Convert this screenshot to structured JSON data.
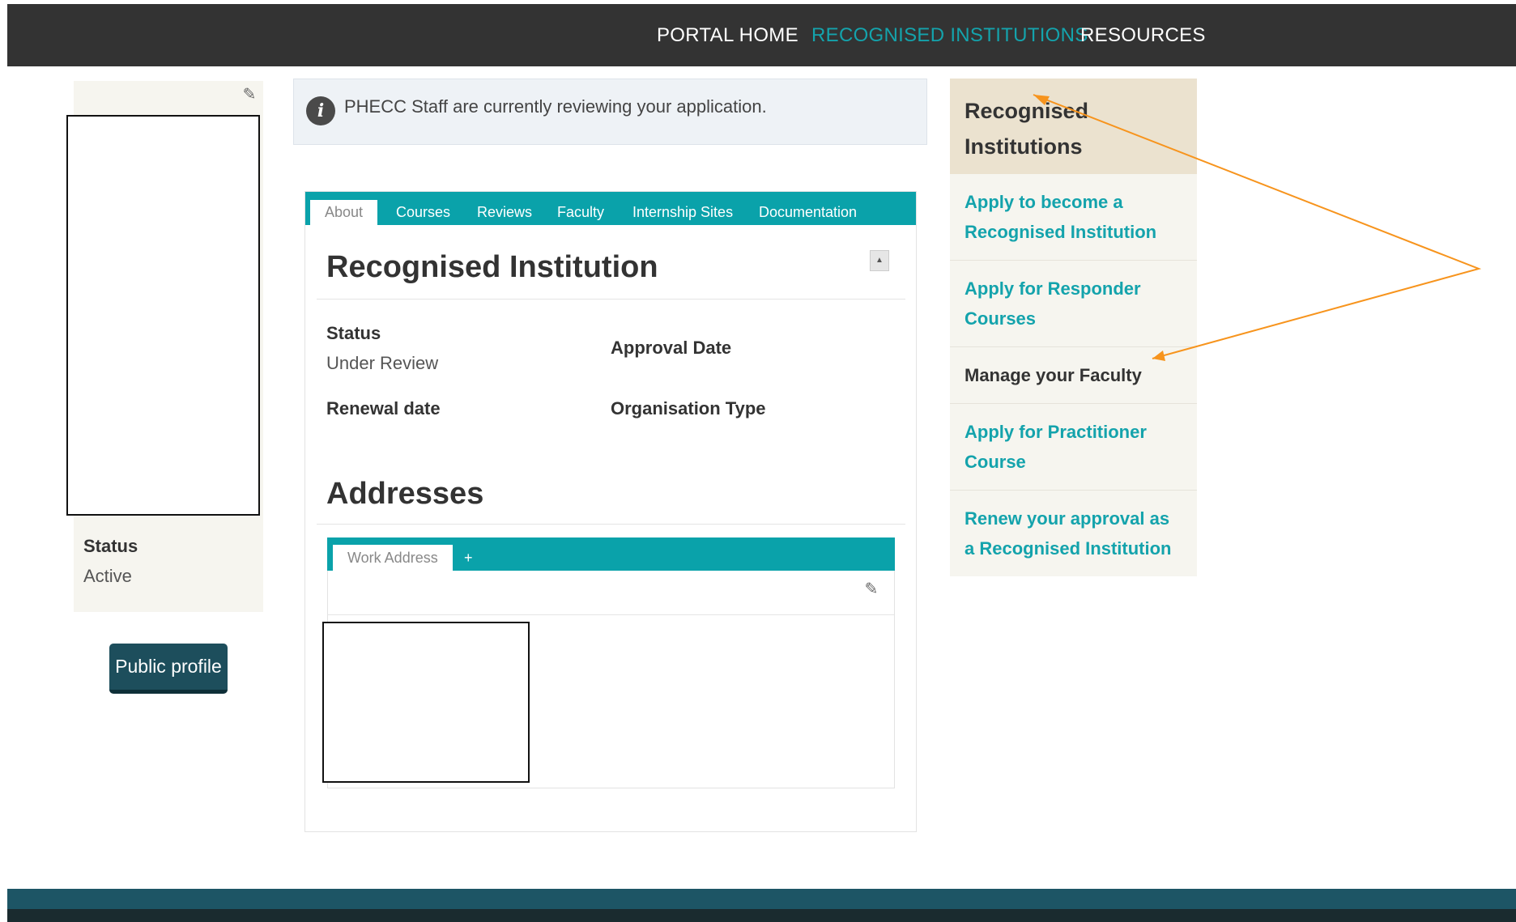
{
  "nav": {
    "items": [
      {
        "label": "PORTAL HOME",
        "active": false
      },
      {
        "label": "RECOGNISED INSTITUTIONS",
        "active": true
      },
      {
        "label": "RESOURCES",
        "active": false
      }
    ]
  },
  "profile": {
    "status_label": "Status",
    "status_value": "Active",
    "public_profile_label": "Public profile"
  },
  "alert": {
    "icon": "info-icon",
    "message": "PHECC Staff are currently reviewing your application."
  },
  "tabs": [
    "About",
    "Courses",
    "Reviews",
    "Faculty",
    "Internship Sites",
    "Documentation"
  ],
  "institution": {
    "title": "Recognised Institution",
    "status_label": "Status",
    "status_value": "Under Review",
    "approval_date_label": "Approval Date",
    "approval_date_value": "",
    "renewal_date_label": "Renewal date",
    "renewal_date_value": "",
    "org_type_label": "Organisation Type",
    "org_type_value": ""
  },
  "addresses": {
    "title": "Addresses",
    "tab_label": "Work Address",
    "add_label": "+"
  },
  "sidebar": {
    "heading": "Recognised Institutions",
    "items": [
      {
        "label": "Apply to become a Recognised Institution",
        "current": false
      },
      {
        "label": "Apply for Responder Courses",
        "current": false
      },
      {
        "label": "Manage your Faculty",
        "current": true
      },
      {
        "label": "Apply for Practitioner Course",
        "current": false
      },
      {
        "label": "Renew your approval as a Recognised Institution",
        "current": false
      }
    ]
  },
  "colors": {
    "nav_bg": "#333333",
    "accent_teal": "#0aa2aa",
    "link_teal": "#14a3ac",
    "sidebar_head_bg": "#ebe2cf",
    "button_bg": "#1d4e5c",
    "annotation_orange": "#f7941d"
  }
}
